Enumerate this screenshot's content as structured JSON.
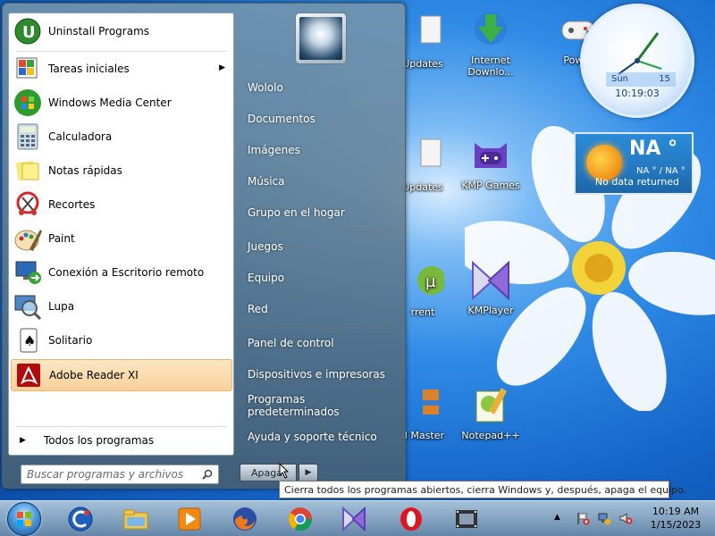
{
  "desktop": {
    "icons": [
      {
        "label": "Updates",
        "icon": "updates-icon"
      },
      {
        "label": "Internet Downlo...",
        "icon": "internet-download-manager-icon"
      },
      {
        "label": "Power",
        "icon": "gamepad-icon"
      },
      {
        "label": "Updates",
        "icon": "updates-icon"
      },
      {
        "label": "KMP Games",
        "icon": "kmp-games-icon"
      },
      {
        "label": "rrent",
        "icon": "utorrent-icon"
      },
      {
        "label": "KMPlayer",
        "icon": "kmplayer-icon"
      },
      {
        "label": "d Master",
        "icon": "disk-master-icon"
      },
      {
        "label": "Notepad++",
        "icon": "notepad-plus-plus-icon"
      }
    ]
  },
  "gadgets": {
    "clock": {
      "day": "Sun",
      "date": "15",
      "time": "10:19:03"
    },
    "weather": {
      "temp": "NA °",
      "range": "NA ° / NA °",
      "message": "No data returned"
    }
  },
  "start_menu": {
    "programs": [
      {
        "label": "Uninstall Programs",
        "icon": "uninstall-programs-icon",
        "has_submenu": false
      },
      {
        "label": "Tareas iniciales",
        "icon": "getting-started-icon",
        "has_submenu": true
      },
      {
        "label": "Windows Media Center",
        "icon": "media-center-icon",
        "has_submenu": false
      },
      {
        "label": "Calculadora",
        "icon": "calculator-icon",
        "has_submenu": false
      },
      {
        "label": "Notas rápidas",
        "icon": "sticky-notes-icon",
        "has_submenu": false
      },
      {
        "label": "Recortes",
        "icon": "snipping-tool-icon",
        "has_submenu": false
      },
      {
        "label": "Paint",
        "icon": "paint-icon",
        "has_submenu": false
      },
      {
        "label": "Conexión a Escritorio remoto",
        "icon": "remote-desktop-icon",
        "has_submenu": false
      },
      {
        "label": "Lupa",
        "icon": "magnifier-icon",
        "has_submenu": false
      },
      {
        "label": "Solitario",
        "icon": "solitaire-icon",
        "has_submenu": false
      },
      {
        "label": "Adobe Reader XI",
        "icon": "adobe-reader-icon",
        "has_submenu": false
      }
    ],
    "all_programs": "Todos los programas",
    "search_placeholder": "Buscar programas y archivos",
    "right_items": [
      "Wololo",
      "Documentos",
      "Imágenes",
      "Música",
      "Grupo en el hogar",
      "Juegos",
      "Equipo",
      "Red",
      "Panel de control",
      "Dispositivos e impresoras",
      "Programas predeterminados",
      "Ayuda y soporte técnico"
    ],
    "shutdown_label": "Apagar",
    "shutdown_tooltip": "Cierra todos los programas abiertos, cierra Windows y, después, apaga el equipo."
  },
  "taskbar": {
    "pinned": [
      {
        "name": "ccleaner",
        "icon": "ccleaner-icon"
      },
      {
        "name": "explorer",
        "icon": "folder-icon"
      },
      {
        "name": "media-player",
        "icon": "media-player-icon"
      },
      {
        "name": "firefox",
        "icon": "firefox-icon"
      },
      {
        "name": "chrome",
        "icon": "chrome-icon"
      },
      {
        "name": "kmplayer",
        "icon": "kmplayer-icon"
      },
      {
        "name": "opera",
        "icon": "opera-icon"
      },
      {
        "name": "video-editor",
        "icon": "film-icon"
      }
    ],
    "tray": {
      "time": "10:19 AM",
      "date": "1/15/2023"
    }
  },
  "colors": {
    "desktop_blue": "#1565c8",
    "highlight": "#f8d19a",
    "tooltip_border": "#767676"
  }
}
